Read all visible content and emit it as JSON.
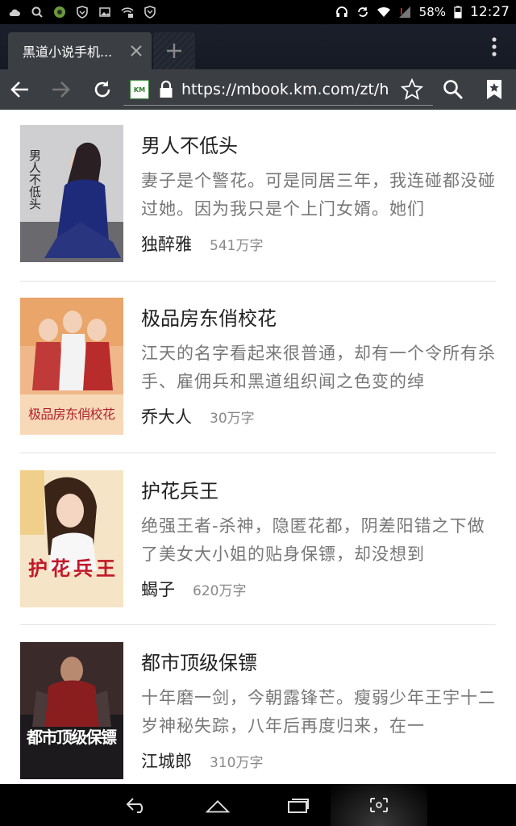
{
  "status_bar": {
    "battery": "58%",
    "time": "12:27",
    "icons": [
      "cloud-icon",
      "search-icon",
      "wechat-icon",
      "shield-icon",
      "image-icon",
      "wifi-lock-icon",
      "shield-outline-icon",
      "headset-icon",
      "sync-icon",
      "wifi-icon",
      "signal-icon",
      "battery-icon"
    ]
  },
  "browser": {
    "tab_title": "黑道小说手机...",
    "url": "https://mbook.km.com/zt/h",
    "site_badge": "KM"
  },
  "books": [
    {
      "title": "男人不低头",
      "description": "妻子是个警花。可是同居三年，我连碰都没碰过她。因为我只是个上门女婿。她们",
      "author": "独醉雅",
      "words": "541万字",
      "cover_text": "男人不低头"
    },
    {
      "title": "极品房东俏校花",
      "description": "江天的名字看起来很普通，却有一个令所有杀手、雇佣兵和黑道组织闻之色变的绰",
      "author": "乔大人",
      "words": "30万字",
      "cover_text": "极品房东俏校花"
    },
    {
      "title": "护花兵王",
      "description": "绝强王者-杀神，隐匿花都，阴差阳错之下做了美女大小姐的贴身保镖，却没想到",
      "author": "蝎子",
      "words": "620万字",
      "cover_text": "护花兵王"
    },
    {
      "title": "都市顶级保镖",
      "description": "十年磨一剑，今朝露锋芒。瘦弱少年王宇十二岁神秘失踪，八年后再度归来，在一",
      "author": "江城郎",
      "words": "310万字",
      "cover_text": "都市顶级保镖"
    }
  ],
  "colors": {
    "status_bg": "#000000",
    "tab_bg": "#1a1f2b",
    "toolbar_bg": "#3b3f44",
    "title_text": "#222222",
    "desc_text": "#777777"
  }
}
